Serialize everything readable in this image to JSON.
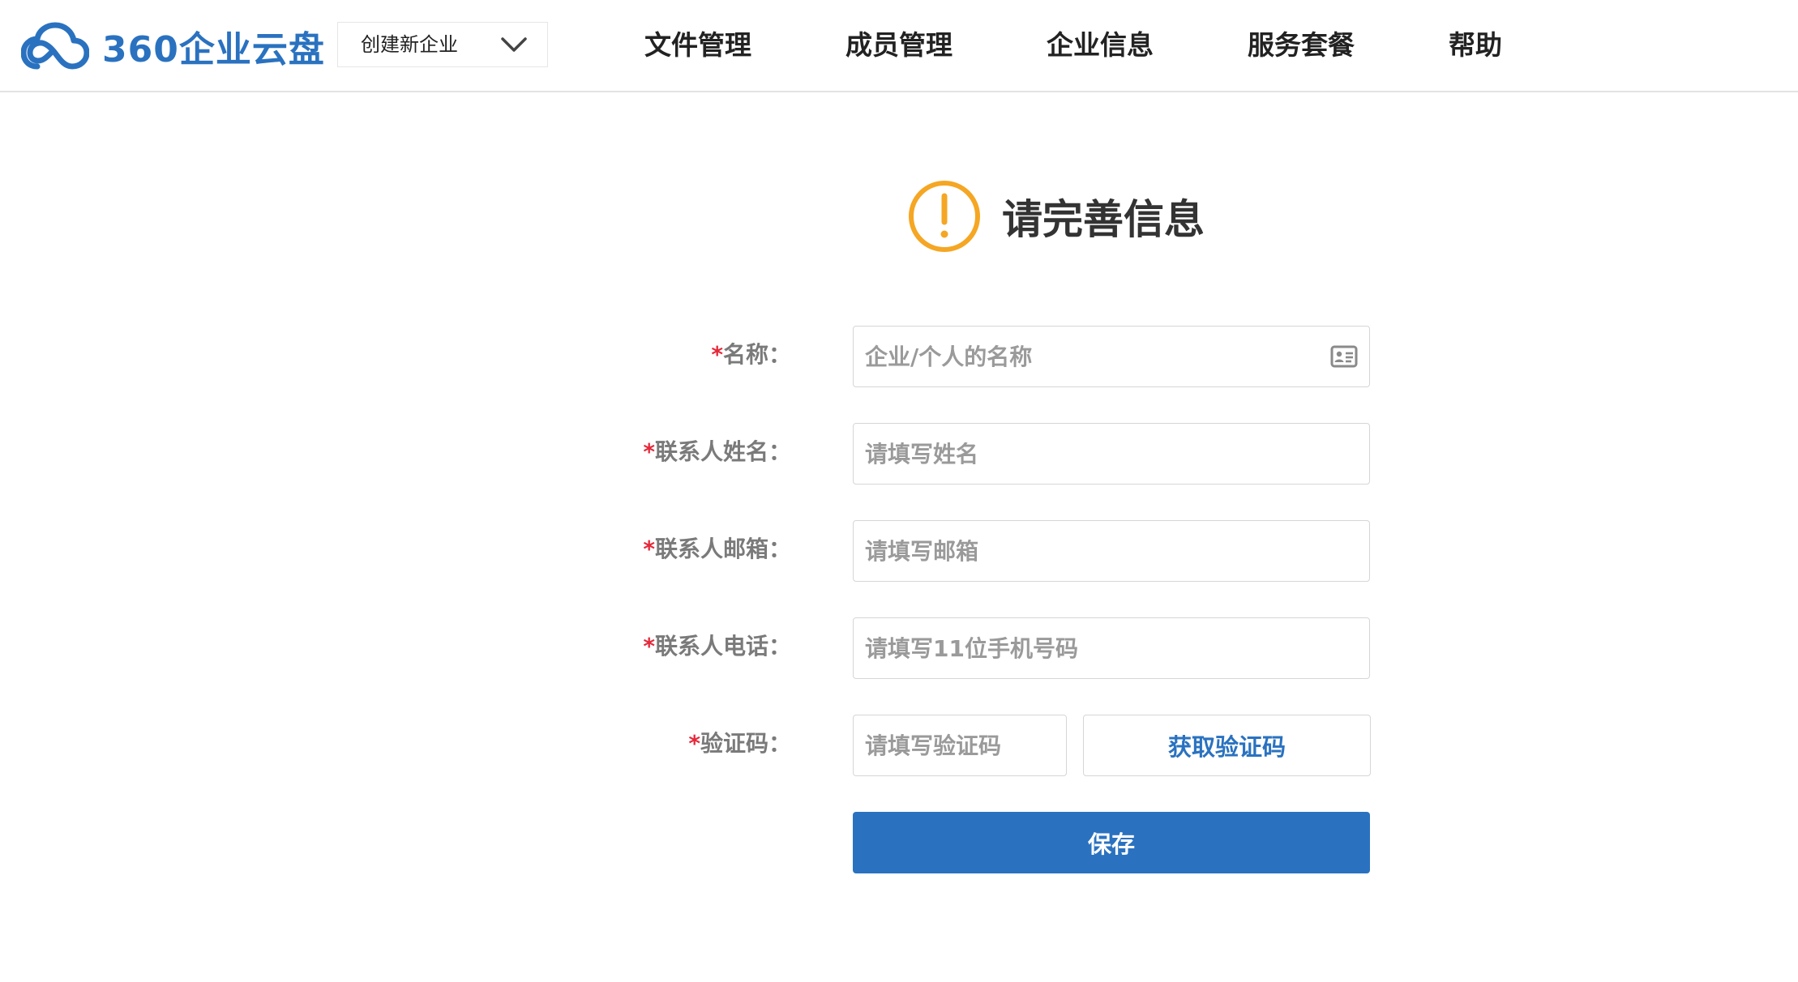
{
  "header": {
    "logo_text": "360企业云盘",
    "org_select": {
      "selected": "创建新企业",
      "icon": "chevron-down-icon"
    },
    "nav": [
      {
        "label": "文件管理"
      },
      {
        "label": "成员管理"
      },
      {
        "label": "企业信息"
      },
      {
        "label": "服务套餐"
      },
      {
        "label": "帮助"
      }
    ]
  },
  "page": {
    "title": "请完善信息",
    "title_icon": "warning-circle-icon"
  },
  "form": {
    "required_mark": "*",
    "fields": {
      "name": {
        "label": "名称：",
        "placeholder": "企业/个人的名称",
        "value": "",
        "icon": "id-card-icon"
      },
      "contact_name": {
        "label": "联系人姓名：",
        "placeholder": "请填写姓名",
        "value": ""
      },
      "contact_email": {
        "label": "联系人邮箱：",
        "placeholder": "请填写邮箱",
        "value": ""
      },
      "contact_phone": {
        "label": "联系人电话：",
        "placeholder": "请填写11位手机号码",
        "value": ""
      },
      "verification_code": {
        "label": "验证码：",
        "placeholder": "请填写验证码",
        "value": ""
      }
    },
    "get_code_label": "获取验证码",
    "save_label": "保存"
  },
  "colors": {
    "brand": "#2a72c0",
    "warning": "#f5a623",
    "required": "#e5293a",
    "border": "#d6d6d6",
    "label": "#7a7a7a"
  }
}
